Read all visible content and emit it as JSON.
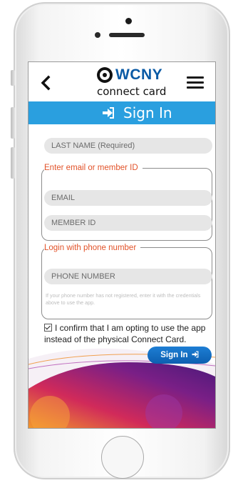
{
  "brand": {
    "logo_text": "WCNY",
    "subtitle": "connect card"
  },
  "header": {
    "title": "Sign In"
  },
  "form": {
    "last_name_placeholder": "LAST NAME (Required)",
    "email_group_label": "Enter email or member ID",
    "email_placeholder": "EMAIL",
    "member_id_placeholder": "MEMBER ID",
    "phone_group_label": "Login with phone number",
    "phone_placeholder": "PHONE NUMBER",
    "phone_hint": "If your phone number has not registered, enter it with the credentials above to use the app.",
    "confirm_text": "I confirm that I am opting to use the app instead of the physical Connect Card.",
    "confirm_checked": true,
    "submit_label": "Sign In"
  },
  "icons": {
    "back": "chevron-left-icon",
    "menu": "hamburger-menu-icon",
    "signin": "sign-in-arrow-icon"
  },
  "colors": {
    "brand_blue": "#0a5aa5",
    "header_bar": "#2a9fdf",
    "label_orange": "#e2532a",
    "button": "#1d7ed4"
  }
}
